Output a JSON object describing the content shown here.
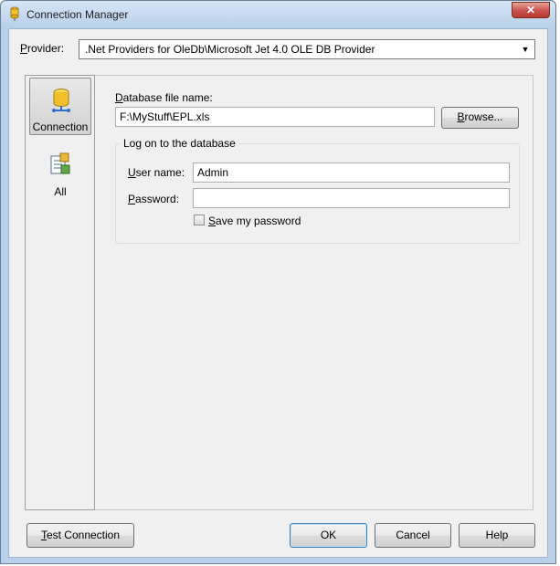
{
  "window": {
    "title": "Connection Manager",
    "close_symbol": "✕"
  },
  "provider": {
    "label": "Provider:",
    "value": ".Net Providers for OleDb\\Microsoft Jet 4.0 OLE DB Provider"
  },
  "nav": {
    "items": [
      {
        "label": "Connection",
        "icon": "database-icon",
        "selected": true
      },
      {
        "label": "All",
        "icon": "properties-icon",
        "selected": false
      }
    ]
  },
  "connection": {
    "db_file_label": "Database file name:",
    "db_file_value": "F:\\MyStuff\\EPL.xls",
    "browse_label": "Browse...",
    "logon_group_label": "Log on to the database",
    "username_label": "User name:",
    "username_value": "Admin",
    "password_label": "Password:",
    "password_value": "",
    "save_password_label": "Save my password",
    "save_password_checked": false
  },
  "buttons": {
    "test_connection": "Test Connection",
    "ok": "OK",
    "cancel": "Cancel",
    "help": "Help"
  }
}
